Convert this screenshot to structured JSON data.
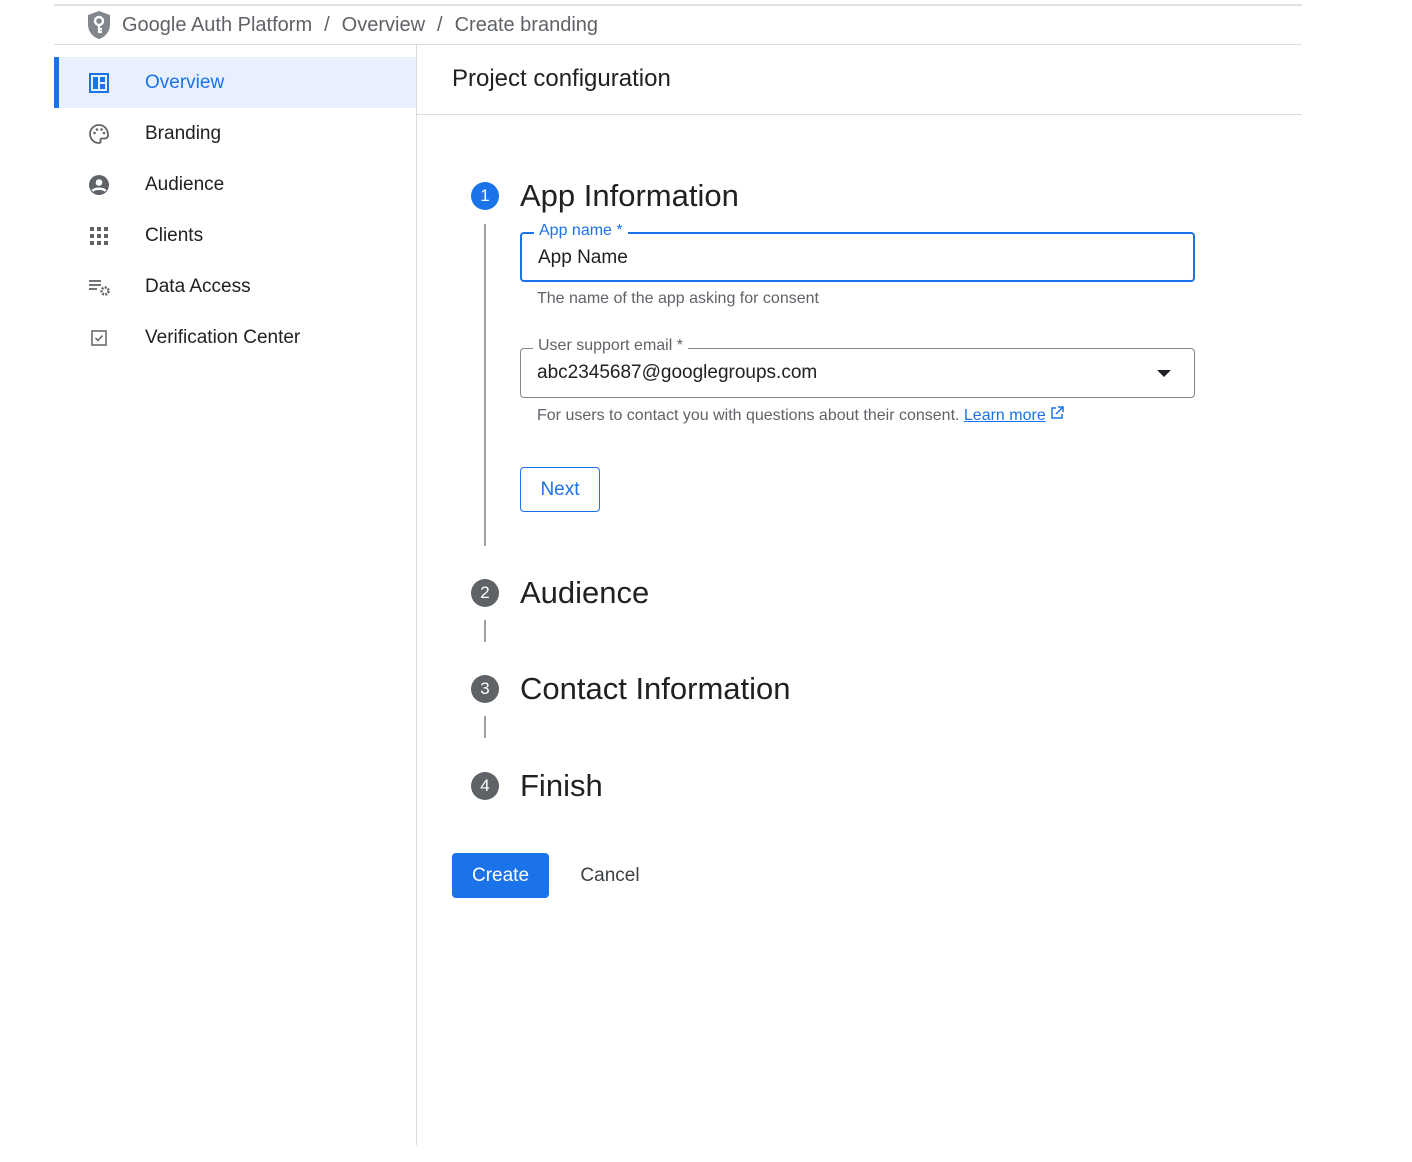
{
  "breadcrumb": [
    "Google Auth Platform",
    "Overview",
    "Create branding"
  ],
  "sidebar": {
    "items": [
      {
        "label": "Overview",
        "icon": "dashboard-icon",
        "active": true
      },
      {
        "label": "Branding",
        "icon": "palette-icon"
      },
      {
        "label": "Audience",
        "icon": "account-circle-icon"
      },
      {
        "label": "Clients",
        "icon": "apps-grid-icon"
      },
      {
        "label": "Data Access",
        "icon": "list-settings-icon"
      },
      {
        "label": "Verification Center",
        "icon": "checkbox-icon"
      }
    ]
  },
  "page_title": "Project configuration",
  "steps": [
    {
      "num": "1",
      "title": "App Information"
    },
    {
      "num": "2",
      "title": "Audience"
    },
    {
      "num": "3",
      "title": "Contact Information"
    },
    {
      "num": "4",
      "title": "Finish"
    }
  ],
  "form": {
    "app_name_label": "App name *",
    "app_name_value": "App Name",
    "app_name_hint": "The name of the app asking for consent",
    "email_label": "User support email *",
    "email_value": "abc2345687@googlegroups.com",
    "email_hint": "For users to contact you with questions about their consent.",
    "learn_more": "Learn more",
    "next": "Next"
  },
  "actions": {
    "create": "Create",
    "cancel": "Cancel"
  },
  "colors": {
    "accent": "#1a73e8"
  }
}
